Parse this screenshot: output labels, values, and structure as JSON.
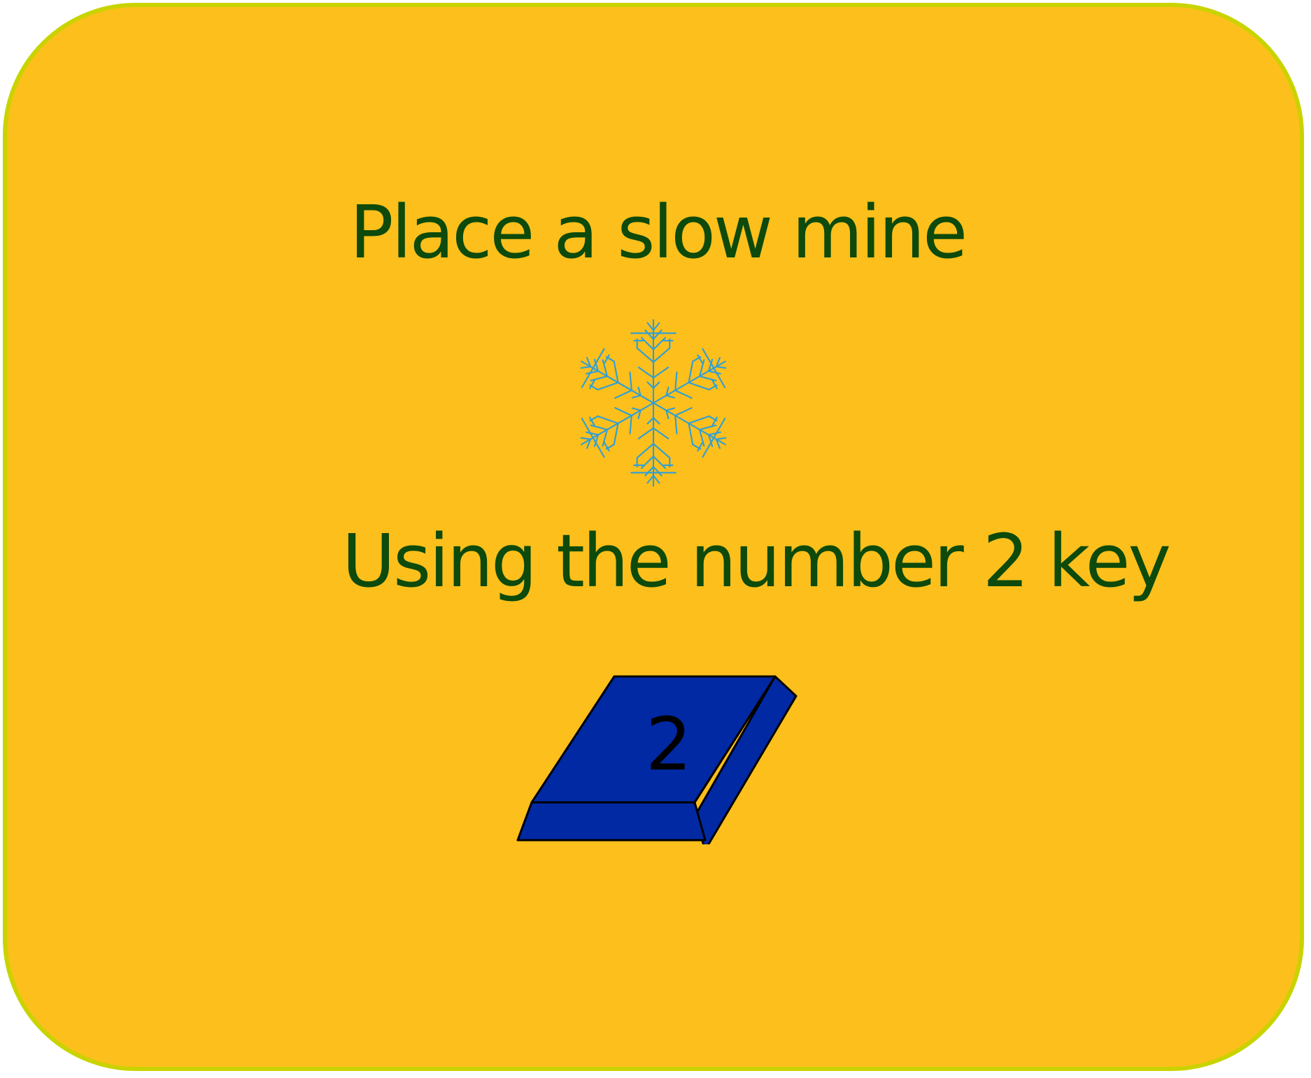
{
  "instruction": {
    "title": "Place a slow mine",
    "subtitle": "Using the number 2 key"
  },
  "icons": {
    "mine_icon": "snowflake-icon"
  },
  "key": {
    "label": "2"
  },
  "colors": {
    "background": "#FDBF1B",
    "border": "#C9D300",
    "text": "#0D4A0B",
    "snowflake": "#2E9FD6",
    "key_face": "#0029A3",
    "key_label": "#000000"
  }
}
